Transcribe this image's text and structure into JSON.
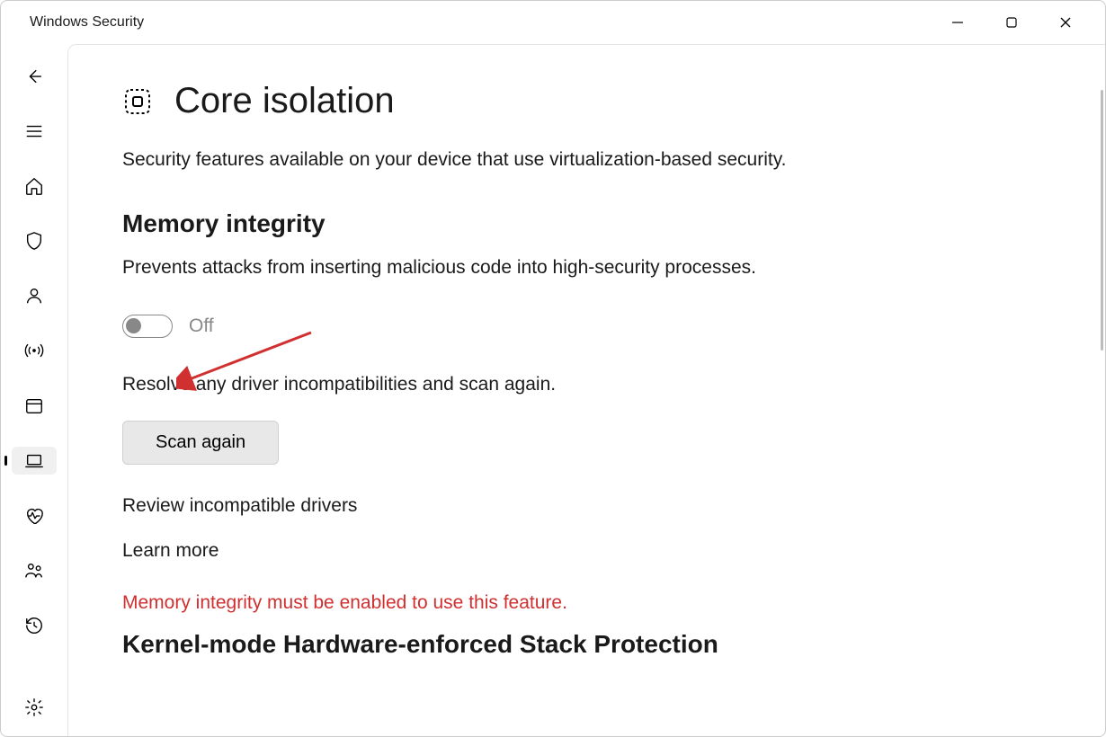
{
  "window": {
    "title": "Windows Security"
  },
  "page": {
    "title": "Core isolation",
    "description": "Security features available on your device that use virtualization-based security."
  },
  "memory_integrity": {
    "title": "Memory integrity",
    "description": "Prevents attacks from inserting malicious code into high-security processes.",
    "toggle_state": "Off",
    "resolve_text": "Resolve any driver incompatibilities and scan again.",
    "scan_button": "Scan again",
    "review_link": "Review incompatible drivers",
    "learn_more": "Learn more"
  },
  "stack_protection": {
    "warning": "Memory integrity must be enabled to use this feature.",
    "title": "Kernel-mode Hardware-enforced Stack Protection"
  },
  "nav": {
    "back": "back",
    "menu": "menu",
    "home": "home",
    "virus": "virus-threat",
    "account": "account-protection",
    "firewall": "firewall-network",
    "app_browser": "app-browser-control",
    "device_security": "device-security",
    "device_performance": "device-performance-health",
    "family": "family-options",
    "history": "protection-history",
    "settings": "settings"
  }
}
